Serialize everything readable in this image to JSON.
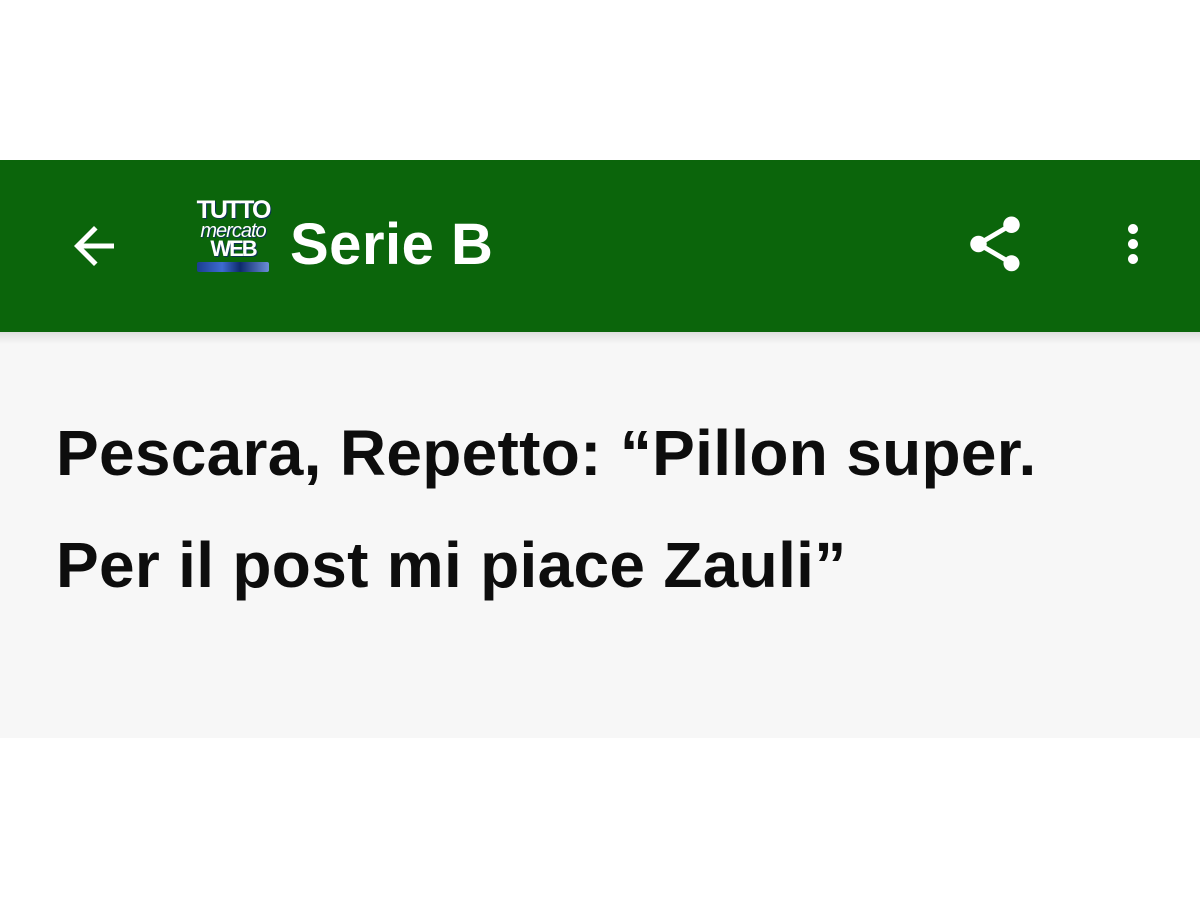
{
  "app_bar": {
    "title": "Serie B",
    "background_color": "#0b650b",
    "back_icon": "arrow-back-icon",
    "share_icon": "share-icon",
    "more_icon": "more-vert-icon",
    "logo": {
      "line1": "TUTTO",
      "line2": "mercato",
      "line3": "WEB"
    }
  },
  "article": {
    "headline": "Pescara, Repetto: “Pillon super. Per il post mi piace Zauli”"
  }
}
